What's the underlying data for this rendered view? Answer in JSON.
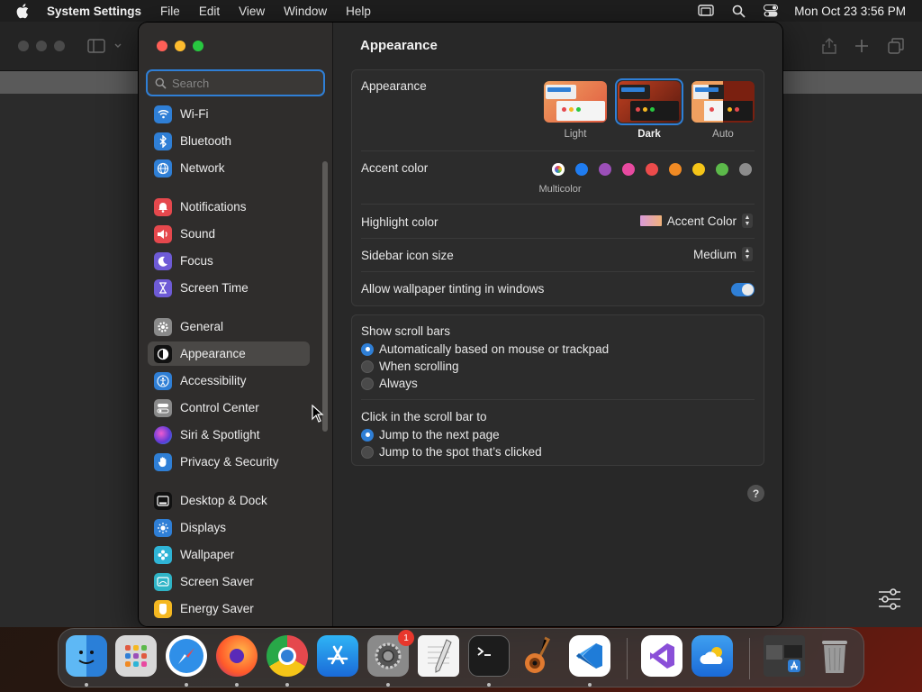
{
  "menubar": {
    "app_name": "System Settings",
    "items": [
      "File",
      "Edit",
      "View",
      "Window",
      "Help"
    ],
    "clock": "Mon Oct 23  3:56 PM"
  },
  "search": {
    "placeholder": "Search"
  },
  "sidebar": {
    "items": [
      {
        "label": "Wi-Fi",
        "icon": "wifi-icon",
        "color": "#2f7fd6"
      },
      {
        "label": "Bluetooth",
        "icon": "bluetooth-icon",
        "color": "#2f7fd6"
      },
      {
        "label": "Network",
        "icon": "globe-icon",
        "color": "#2f7fd6"
      },
      {
        "label": "Notifications",
        "icon": "bell-icon",
        "color": "#e5484d"
      },
      {
        "label": "Sound",
        "icon": "speaker-icon",
        "color": "#e5484d"
      },
      {
        "label": "Focus",
        "icon": "moon-icon",
        "color": "#6e5bd6"
      },
      {
        "label": "Screen Time",
        "icon": "hourglass-icon",
        "color": "#6e5bd6"
      },
      {
        "label": "General",
        "icon": "gear-icon",
        "color": "#8a8a8a"
      },
      {
        "label": "Appearance",
        "icon": "appearance-icon",
        "color": "#111111"
      },
      {
        "label": "Accessibility",
        "icon": "accessibility-icon",
        "color": "#2f7fd6"
      },
      {
        "label": "Control Center",
        "icon": "toggles-icon",
        "color": "#8a8a8a"
      },
      {
        "label": "Siri & Spotlight",
        "icon": "siri-icon",
        "color": "#9b4fd6"
      },
      {
        "label": "Privacy & Security",
        "icon": "hand-icon",
        "color": "#2f7fd6"
      },
      {
        "label": "Desktop & Dock",
        "icon": "dock-icon",
        "color": "#111111"
      },
      {
        "label": "Displays",
        "icon": "sun-icon",
        "color": "#2f7fd6"
      },
      {
        "label": "Wallpaper",
        "icon": "flower-icon",
        "color": "#2fb4d6"
      },
      {
        "label": "Screen Saver",
        "icon": "screensaver-icon",
        "color": "#2fb4c6"
      },
      {
        "label": "Energy Saver",
        "icon": "battery-icon",
        "color": "#f5b821"
      }
    ],
    "selected": "Appearance"
  },
  "content": {
    "title": "Appearance",
    "appearance": {
      "label": "Appearance",
      "options": [
        "Light",
        "Dark",
        "Auto"
      ],
      "selected": "Dark"
    },
    "accent": {
      "label": "Accent color",
      "selected_name": "Multicolor",
      "colors": [
        "#ffffff",
        "#1f7cf0",
        "#9b4fb8",
        "#e84aa0",
        "#ec4b4b",
        "#f08a24",
        "#f5c518",
        "#5cb94a",
        "#8c8c8c"
      ]
    },
    "highlight": {
      "label": "Highlight color",
      "value": "Accent Color"
    },
    "sidebar_icon": {
      "label": "Sidebar icon size",
      "value": "Medium"
    },
    "tinting": {
      "label": "Allow wallpaper tinting in windows",
      "enabled": true
    },
    "scrollbars": {
      "label": "Show scroll bars",
      "options": [
        "Automatically based on mouse or trackpad",
        "When scrolling",
        "Always"
      ],
      "selected": 0
    },
    "click_scroll": {
      "label": "Click in the scroll bar to",
      "options": [
        "Jump to the next page",
        "Jump to the spot that’s clicked"
      ],
      "selected": 0
    },
    "help_label": "?"
  },
  "dock": {
    "apps": [
      "Finder",
      "Launchpad",
      "Safari",
      "Firefox",
      "Chrome",
      "App Store",
      "System Settings",
      "TextEdit",
      "Terminal",
      "GarageBand",
      "Visual Studio Code",
      "Visual Studio",
      "Weather",
      "Downloads",
      "Trash"
    ],
    "settings_badge": "1"
  },
  "colors": {
    "accent": "#2f7fd6",
    "window_bg": "#282828",
    "sidebar_bg": "#2f2d2c"
  }
}
